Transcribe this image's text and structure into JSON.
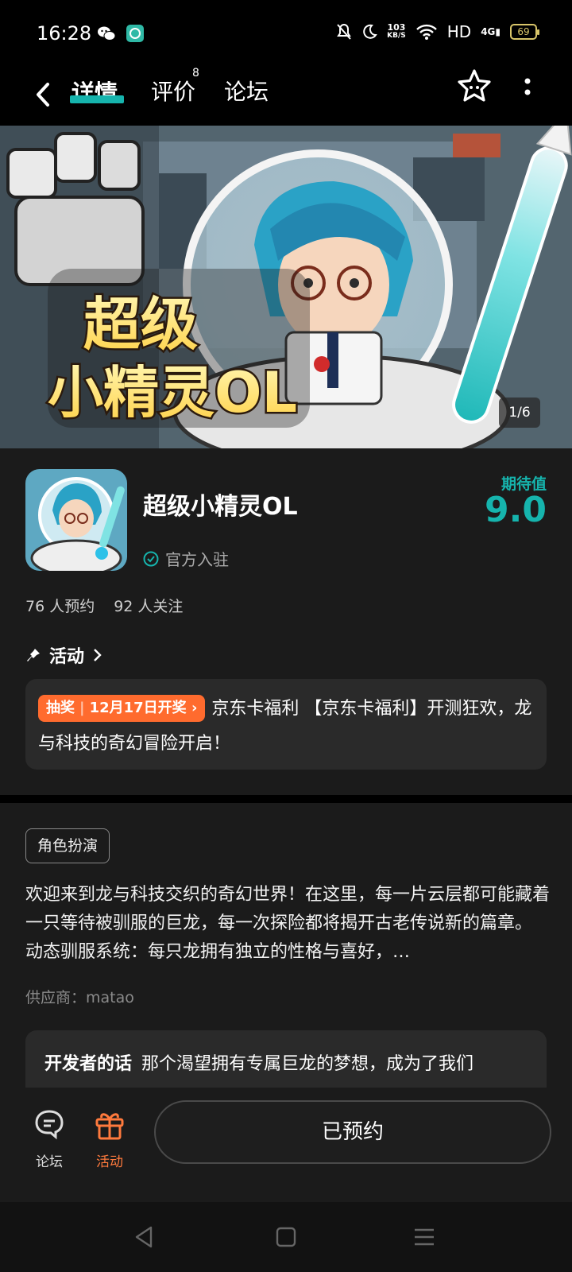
{
  "status_bar": {
    "time": "16:28",
    "netspeed_value": "103",
    "netspeed_unit": "KB/S",
    "network": "HD",
    "signal": "4G",
    "battery": "69",
    "icons": [
      "wechat-icon",
      "app-notify-icon",
      "mute-icon",
      "moon-icon",
      "wifi-icon",
      "signal-icon",
      "battery-icon"
    ]
  },
  "nav": {
    "tabs": [
      {
        "label": "详情",
        "active": true
      },
      {
        "label": "评价",
        "count": "8"
      },
      {
        "label": "论坛"
      }
    ]
  },
  "banner": {
    "page_indicator": "1/6",
    "title_art": "超级小精灵OL"
  },
  "app": {
    "name": "超级小精灵OL",
    "verified_label": "官方入驻",
    "expect_label": "期待值",
    "expect_value": "9.0",
    "reservations": "76 人预约",
    "followers": "92 人关注"
  },
  "activity": {
    "heading": "活动",
    "badge_type": "抽奖",
    "badge_date": "12月17日开奖",
    "text": "京东卡福利 【京东卡福利】开测狂欢，龙与科技的奇幻冒险开启！"
  },
  "details": {
    "genre_tag": "角色扮演",
    "description": "欢迎来到龙与科技交织的奇幻世界！在这里，每一片云层都可能藏着一只等待被驯服的巨龙，每一次探险都将揭开古老传说新的篇章。 动态驯服系统：每只龙拥有独立的性格与喜好，…",
    "supplier": "供应商：matao",
    "dev_label": "开发者的话",
    "dev_text": "那个渴望拥有专属巨龙的梦想，成为了我们"
  },
  "bottom_bar": {
    "forum_label": "论坛",
    "activity_label": "活动",
    "reserved_label": "已预约"
  },
  "colors": {
    "accent": "#16b4ad",
    "orange": "#ff6b2e",
    "background": "#1b1b1b"
  }
}
